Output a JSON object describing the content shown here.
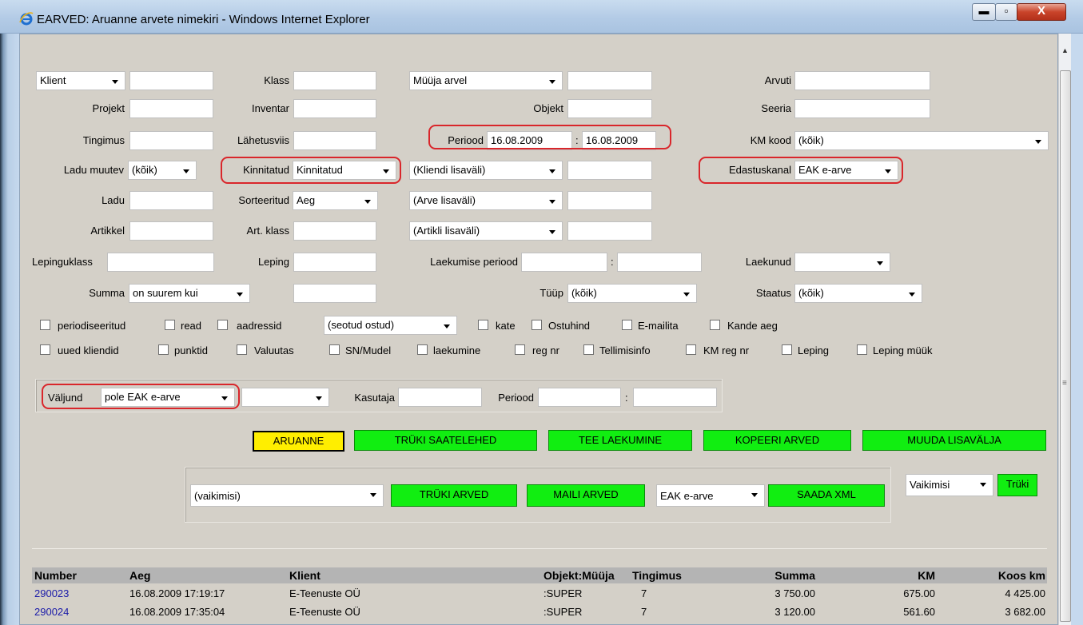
{
  "window": {
    "title": "EARVED: Aruanne arvete nimekiri - Windows Internet Explorer",
    "min_glyph": "▬",
    "max_glyph": "▫",
    "close_glyph": "X"
  },
  "filters": {
    "klient_select": "Klient",
    "klass_label": "Klass",
    "muuja_select": "Müüja arvel",
    "arvuti_label": "Arvuti",
    "projekt_label": "Projekt",
    "inventar_label": "Inventar",
    "objekt_label": "Objekt",
    "seeria_label": "Seeria",
    "tingimus_label": "Tingimus",
    "lahetusviis_label": "Lähetusviis",
    "periood_label": "Periood",
    "periood_from": "16.08.2009",
    "periood_sep": ":",
    "periood_to": "16.08.2009",
    "km_kood_label": "KM kood",
    "km_kood_value": "(kõik)",
    "ladu_muutev_label": "Ladu muutev",
    "ladu_muutev_value": "(kõik)",
    "kinnitatud_label": "Kinnitatud",
    "kinnitatud_value": "Kinnitatud",
    "kliendi_lisavali": "(Kliendi lisaväli)",
    "edastuskanal_label": "Edastuskanal",
    "edastuskanal_value": "EAK e-arve",
    "ladu_label": "Ladu",
    "sorteeritud_label": "Sorteeritud",
    "sorteeritud_value": "Aeg",
    "arve_lisavali": "(Arve lisaväli)",
    "artikkel_label": "Artikkel",
    "art_klass_label": "Art. klass",
    "artikli_lisavali": "(Artikli lisaväli)",
    "lepinguklass_label": "Lepinguklass",
    "leping_label": "Leping",
    "laekumise_periood_label": "Laekumise periood",
    "laekumise_sep": ":",
    "laekunud_label": "Laekunud",
    "summa_label": "Summa",
    "summa_value": "on suurem kui",
    "tuup_label": "Tüüp",
    "tuup_value": "(kõik)",
    "staatus_label": "Staatus",
    "staatus_value": "(kõik)"
  },
  "checkboxes_row1": {
    "periodiseeritud": "periodiseeritud",
    "read": "read",
    "aadressid": "aadressid",
    "seotud_select": "(seotud ostud)",
    "kate": "kate",
    "ostuhind": "Ostuhind",
    "e_mailita": "E-mailita",
    "kande_aeg": "Kande aeg"
  },
  "checkboxes_row2": {
    "uued_kliendid": "uued kliendid",
    "punktid": "punktid",
    "valuutas": "Valuutas",
    "sn_mudel": "SN/Mudel",
    "laekumine": "laekumine",
    "reg_nr": "reg nr",
    "tellimisinfo": "Tellimisinfo",
    "km_reg_nr": "KM reg nr",
    "leping": "Leping",
    "leping_muuk": "Leping müük"
  },
  "output": {
    "valjund_label": "Väljund",
    "valjund_value": "pole EAK e-arve",
    "kasutaja_label": "Kasutaja",
    "periood_label": "Periood",
    "periood_sep": ":"
  },
  "actions": {
    "aruanne": "ARUANNE",
    "truki_saatelehed": "TRÜKI SAATELEHED",
    "tee_laekumine": "TEE LAEKUMINE",
    "kopeeri_arved": "KOPEERI ARVED",
    "muuda_lisavalja": "MUUDA LISAVÄLJA",
    "vaikimisi_select": "(vaikimisi)",
    "truki_arved": "TRÜKI ARVED",
    "maili_arved": "MAILI ARVED",
    "eak_select": "EAK e-arve",
    "saada_xml": "SAADA XML",
    "vaikimisi2_select": "Vaikimisi",
    "truki": "Trüki"
  },
  "table": {
    "headers": [
      "Number",
      "Aeg",
      "Klient",
      "Objekt:Müüja",
      "Tingimus",
      "Summa",
      "KM",
      "Koos km"
    ],
    "rows": [
      [
        "290023",
        "16.08.2009 17:19:17",
        "E-Teenuste OÜ",
        ":SUPER",
        "7",
        "3 750.00",
        "675.00",
        "4 425.00"
      ],
      [
        "290024",
        "16.08.2009 17:35:04",
        "E-Teenuste OÜ",
        ":SUPER",
        "7",
        "3 120.00",
        "561.60",
        "3 682.00"
      ]
    ]
  }
}
